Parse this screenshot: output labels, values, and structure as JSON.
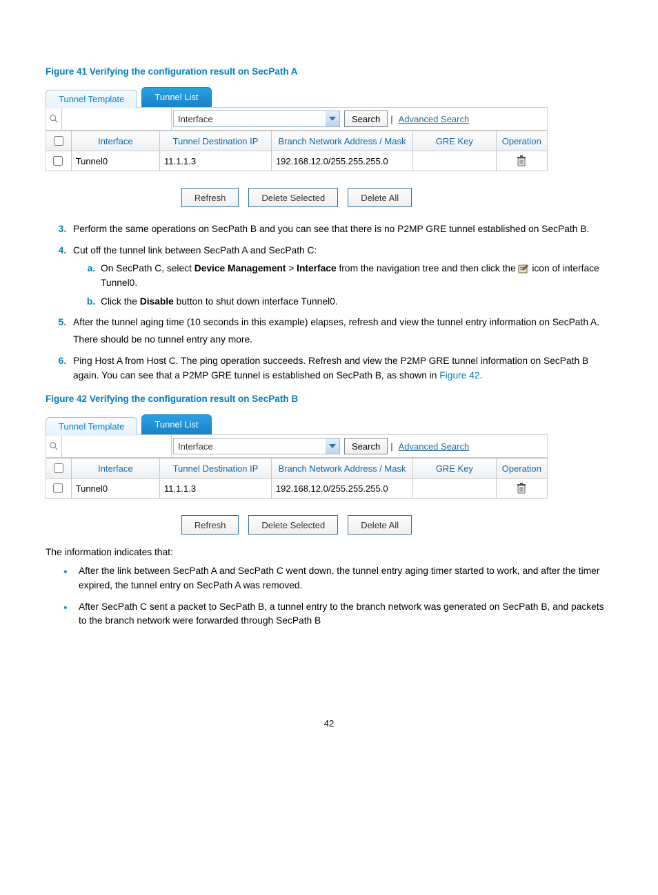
{
  "figure41": {
    "caption": "Figure 41 Verifying the configuration result on SecPath A",
    "tabs": {
      "tunnel_template": "Tunnel Template",
      "tunnel_list": "Tunnel List"
    },
    "filter": {
      "dropdown": "Interface",
      "search_btn": "Search",
      "advanced": "Advanced Search"
    },
    "headers": {
      "interface": "Interface",
      "tdestip": "Tunnel Destination IP",
      "branch": "Branch Network Address / Mask",
      "grekey": "GRE Key",
      "operation": "Operation"
    },
    "row": {
      "interface": "Tunnel0",
      "tdestip": "11.1.1.3",
      "branch": "192.168.12.0/255.255.255.0",
      "grekey": ""
    },
    "buttons": {
      "refresh": "Refresh",
      "delete_selected": "Delete Selected",
      "delete_all": "Delete All"
    }
  },
  "steps": {
    "s3": "Perform the same operations on SecPath B and you can see that there is no P2MP GRE tunnel established on SecPath B.",
    "s4": "Cut off the tunnel link between SecPath A and SecPath C:",
    "s4a_1": "On SecPath C, select ",
    "s4a_dm": "Device Management",
    "s4a_gt": " > ",
    "s4a_if": "Interface",
    "s4a_2": " from the navigation tree and then click the ",
    "s4a_3": " icon of interface Tunnel0.",
    "s4b_1": "Click the ",
    "s4b_disable": "Disable",
    "s4b_2": " button to shut down interface Tunnel0.",
    "s5": "After the tunnel aging time (10 seconds in this example) elapses, refresh and view the tunnel entry information on SecPath A.",
    "s5_p2": "There should be no tunnel entry any more.",
    "s6_1": "Ping Host A from Host C. The ping operation succeeds. Refresh and view the P2MP GRE tunnel information on SecPath B again. You can see that a P2MP GRE tunnel is established on SecPath B, as shown in ",
    "s6_link": "Figure 42",
    "s6_2": "."
  },
  "figure42": {
    "caption": "Figure 42 Verifying the configuration result on SecPath B",
    "tabs": {
      "tunnel_template": "Tunnel Template",
      "tunnel_list": "Tunnel List"
    },
    "filter": {
      "dropdown": "Interface",
      "search_btn": "Search",
      "advanced": "Advanced Search"
    },
    "headers": {
      "interface": "Interface",
      "tdestip": "Tunnel Destination IP",
      "branch": "Branch Network Address / Mask",
      "grekey": "GRE Key",
      "operation": "Operation"
    },
    "row": {
      "interface": "Tunnel0",
      "tdestip": "11.1.1.3",
      "branch": "192.168.12.0/255.255.255.0",
      "grekey": ""
    },
    "buttons": {
      "refresh": "Refresh",
      "delete_selected": "Delete Selected",
      "delete_all": "Delete All"
    }
  },
  "after": {
    "indicates": "The information indicates that:",
    "b1": "After the link between SecPath A and SecPath C went down, the tunnel entry aging timer started to work, and after the timer expired, the tunnel entry on SecPath A was removed.",
    "b2": "After SecPath C sent a packet to SecPath B, a tunnel entry to the branch network was generated on SecPath B, and packets to the branch network were forwarded through SecPath B"
  },
  "page_number": "42"
}
